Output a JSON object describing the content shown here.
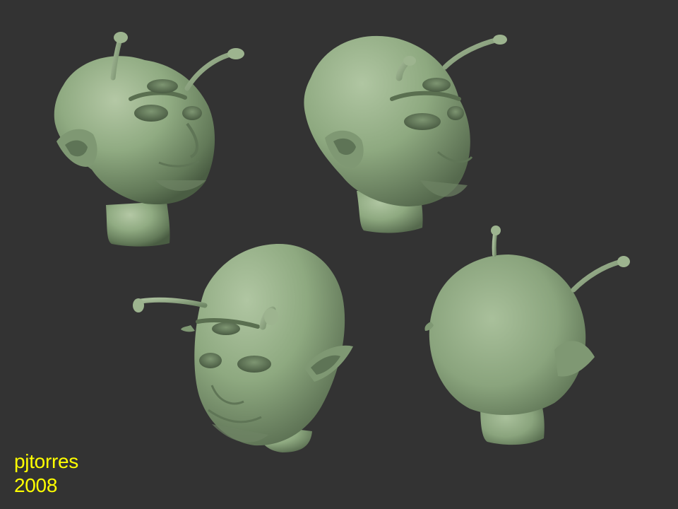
{
  "signature": {
    "author": "pjtorres",
    "year": "2008"
  },
  "colors": {
    "background": "#333333",
    "clay": "#8fa982",
    "signature_text": "#ffff00"
  },
  "render_views": [
    "front-left-three-quarter",
    "front-right-three-quarter",
    "low-front-three-quarter",
    "back"
  ]
}
